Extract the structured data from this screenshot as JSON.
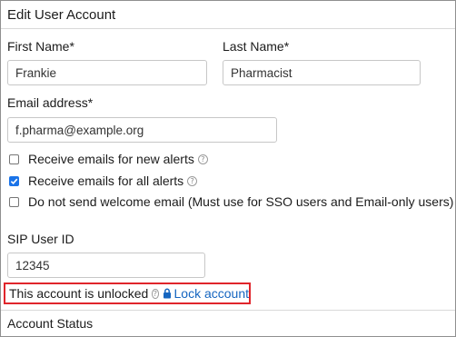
{
  "form": {
    "title": "Edit User Account",
    "first_name": {
      "label": "First Name*",
      "value": "Frankie"
    },
    "last_name": {
      "label": "Last Name*",
      "value": "Pharmacist"
    },
    "email": {
      "label": "Email address*",
      "value": "f.pharma@example.org"
    },
    "checkboxes": [
      {
        "label": "Receive emails for new alerts",
        "checked": false,
        "help": true
      },
      {
        "label": "Receive emails for all alerts",
        "checked": true,
        "help": true
      },
      {
        "label": "Do not send welcome email (Must use for SSO users and Email-only users)",
        "checked": false,
        "help": false
      }
    ],
    "sip": {
      "label": "SIP User ID",
      "value": "12345"
    },
    "lock": {
      "status_text": "This account is unlocked",
      "link_text": "Lock account"
    },
    "account_status_label": "Account Status"
  },
  "colors": {
    "link": "#1565c0",
    "highlight_border": "#e0252b",
    "checkbox_checked": "#1a73e8"
  }
}
